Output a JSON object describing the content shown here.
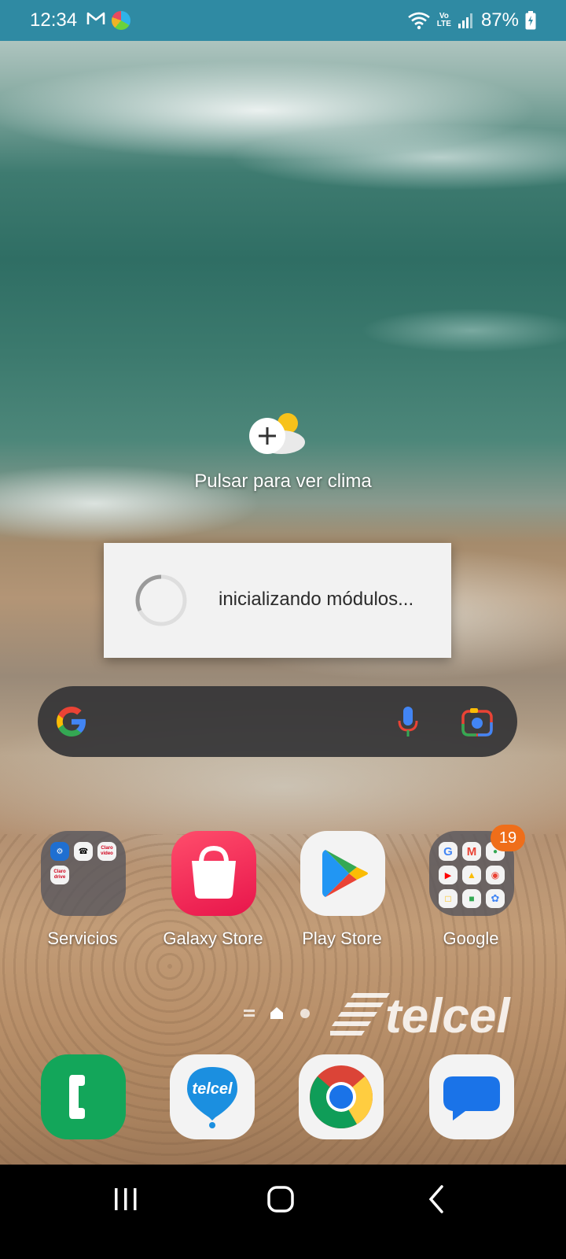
{
  "status_bar": {
    "time": "12:34",
    "left_icons": [
      "gmail-icon",
      "edge-icon"
    ],
    "right_icons": [
      "wifi-icon",
      "volte-icon",
      "signal-icon",
      "battery-charging-icon"
    ],
    "volte_top": "Vo",
    "volte_bottom": "LTE",
    "battery": "87%",
    "background_color": "#2f8aa3"
  },
  "weather_widget": {
    "label": "Pulsar para ver clima",
    "icon": "add-weather-icon"
  },
  "progress_dialog": {
    "message": "inicializando módulos..."
  },
  "search_bar": {
    "icons": [
      "google-g-icon",
      "microphone-icon",
      "google-lens-icon"
    ]
  },
  "apps": [
    {
      "label": "Servicios",
      "type": "folder"
    },
    {
      "label": "Galaxy Store",
      "type": "app"
    },
    {
      "label": "Play Store",
      "type": "app"
    },
    {
      "label": "Google",
      "type": "folder",
      "badge": "19"
    }
  ],
  "servicios_folder_mini": {
    "claro_video": "Claro video",
    "claro_drive": "Claro drive"
  },
  "page_indicator": {
    "pages": 2,
    "current": 1
  },
  "carrier_logo": "telcel",
  "dock": [
    {
      "name": "phone",
      "icon": "phone-icon"
    },
    {
      "name": "telcel",
      "icon": "telcel-balloon-icon",
      "text": "telcel"
    },
    {
      "name": "chrome",
      "icon": "chrome-icon"
    },
    {
      "name": "messages",
      "icon": "messages-icon"
    }
  ],
  "nav_bar": {
    "buttons": [
      "recent-apps-button",
      "home-button",
      "back-button"
    ]
  },
  "colors": {
    "badge": "#ef6e1a",
    "galaxy_store": "#e8154b",
    "phone": "#13a65a"
  }
}
